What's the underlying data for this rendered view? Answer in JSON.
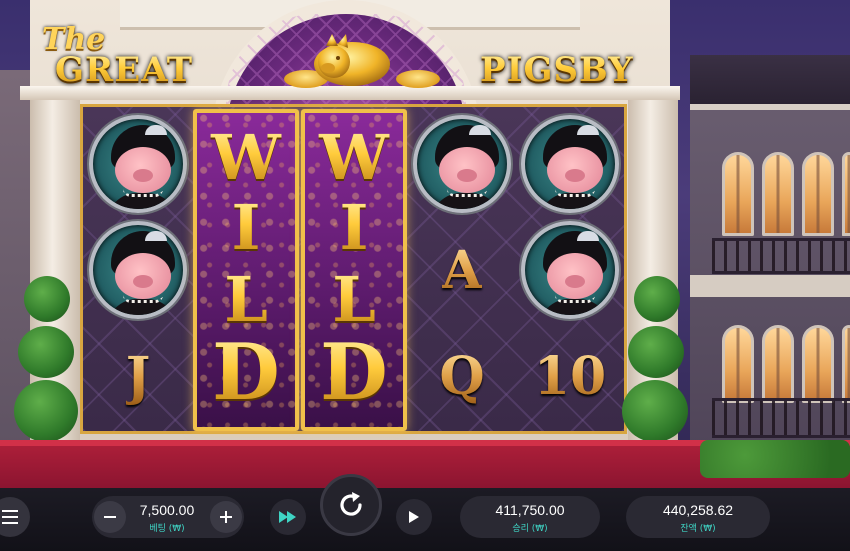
{
  "game": {
    "logo": {
      "line1": "The",
      "line2": "GREAT",
      "line3": "PIGSBY"
    },
    "grid": {
      "reel1": [
        "Pig Lady",
        "Pig Lady",
        "J"
      ],
      "reel2": [
        "WILD"
      ],
      "reel3": [
        "WILD"
      ],
      "reel4": [
        "Pig Lady",
        "A",
        "Q"
      ],
      "reel5": [
        "Pig Lady",
        "Pig Lady",
        "10"
      ]
    },
    "wild_letters": [
      "W",
      "I",
      "L",
      "D"
    ]
  },
  "controls": {
    "menu_icon": "hamburger-menu-icon",
    "bet": {
      "value": "7,500.00",
      "label": "베팅 (₩)"
    },
    "decrease_icon": "minus-icon",
    "increase_icon": "plus-icon",
    "turbo_icon": "fast-forward-icon",
    "spin_icon": "spin-arrow-icon",
    "autoplay_icon": "play-icon",
    "win": {
      "value": "411,750.00",
      "label": "승리 (₩)"
    },
    "balance": {
      "value": "440,258.62",
      "label": "잔액 (₩)"
    },
    "accent_color": "#3fd4c4"
  }
}
